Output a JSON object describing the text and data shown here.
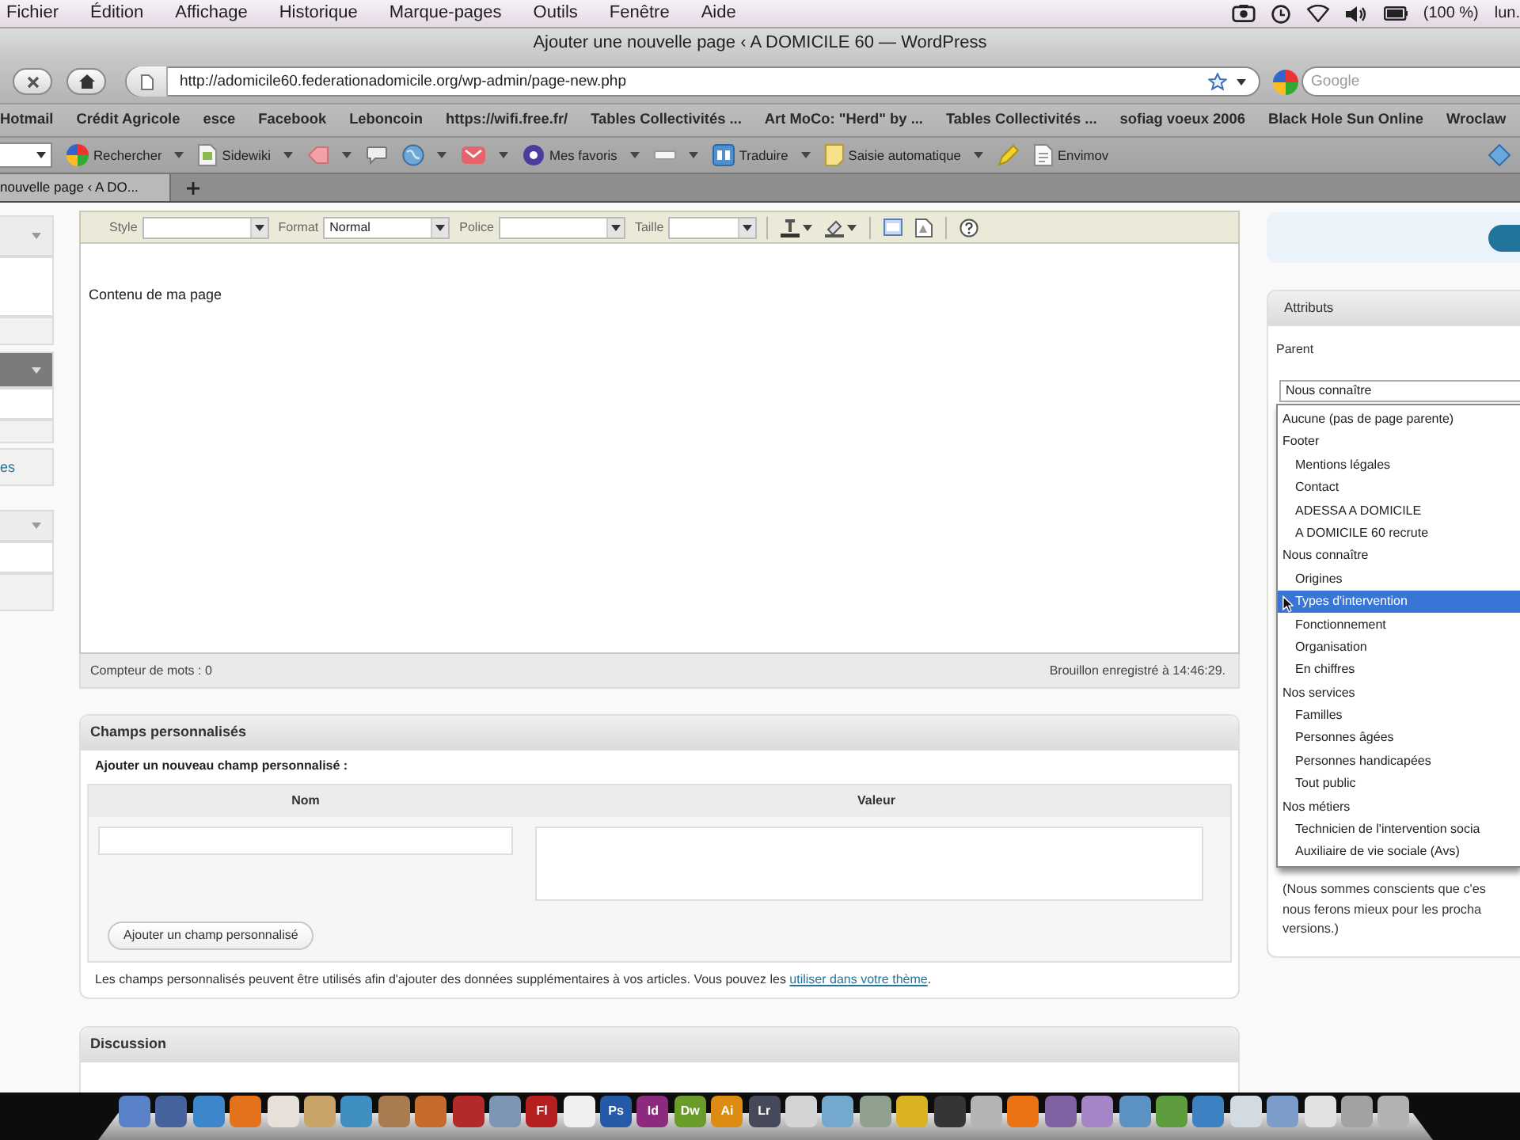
{
  "menu_bar": {
    "items": [
      "Fichier",
      "Édition",
      "Affichage",
      "Historique",
      "Marque-pages",
      "Outils",
      "Fenêtre",
      "Aide"
    ],
    "battery": "(100 %)",
    "clock": "lun."
  },
  "window": {
    "title": "Ajouter une nouvelle page ‹ A DOMICILE 60 — WordPress"
  },
  "nav_bar": {
    "url": "http://adomicile60.federationadomicile.org/wp-admin/page-new.php",
    "search": {
      "placeholder": "Google"
    }
  },
  "bookmarks": [
    "Hotmail",
    "Crédit Agricole",
    "esce",
    "Facebook",
    "Leboncoin",
    "https://wifi.free.fr/",
    "Tables Collectivités ...",
    "Art MoCo: \"Herd\" by ...",
    "Tables Collectivités ...",
    "sofiag voeux 2006",
    "Black Hole Sun Online",
    "Wroclaw"
  ],
  "google_toolbar": {
    "items": [
      {
        "label": "Rechercher",
        "menu": true
      },
      {
        "label": "Sidewiki",
        "menu": true
      },
      {
        "menu": true
      },
      {
        "menu": false
      },
      {
        "menu": true
      },
      {
        "menu": true
      },
      {
        "label": "Mes favoris",
        "menu": true
      },
      {
        "menu": true
      },
      {
        "label": "Traduire",
        "menu": true
      },
      {
        "label": "Saisie automatique",
        "menu": true
      },
      {
        "menu": false
      },
      {
        "label": "Envimov",
        "menu": false
      }
    ]
  },
  "tabs": [
    {
      "label": "nouvelle page ‹ A DO...",
      "selected": true
    }
  ],
  "admin_menu": {
    "link_fragment": "es"
  },
  "editor": {
    "selects": [
      {
        "label": "Style"
      },
      {
        "label": "Format",
        "value": "Normal"
      },
      {
        "label": "Police"
      },
      {
        "label": "Taille"
      }
    ],
    "content": "Contenu de ma page",
    "word_count": "Compteur de mots : 0",
    "draft_status": "Brouillon enregistré à 14:46:29."
  },
  "custom_fields": {
    "title": "Champs personnalisés",
    "subtitle": "Ajouter un nouveau champ personnalisé :",
    "columns": [
      "Nom",
      "Valeur"
    ],
    "add_button": "Ajouter un champ personnalisé",
    "note": "Les champs personnalisés peuvent être utilisés afin d'ajouter des données supplémentaires à vos articles. Vous pouvez les",
    "note_link": "utiliser dans votre thème",
    "note_end": "."
  },
  "discussion": {
    "title": "Discussion"
  },
  "attributes": {
    "title": "Attributs",
    "parent_label": "Parent",
    "parent_value": "Nous connaître",
    "options": [
      {
        "label": "Aucune (pas de page parente)",
        "selected": false
      },
      {
        "label": "Footer",
        "selected": false,
        "children": [
          {
            "label": "Mentions légales",
            "selected": false
          },
          {
            "label": "Contact",
            "selected": false
          },
          {
            "label": "ADESSA A DOMICILE",
            "selected": false
          },
          {
            "label": "A DOMICILE 60 recrute",
            "selected": false
          }
        ]
      },
      {
        "label": "Nous connaître",
        "selected": false,
        "children": [
          {
            "label": "Origines",
            "selected": false
          },
          {
            "label": "Types d'intervention",
            "selected": true
          },
          {
            "label": "Fonctionnement",
            "selected": false
          },
          {
            "label": "Organisation",
            "selected": false
          },
          {
            "label": "En chiffres",
            "selected": false
          }
        ]
      },
      {
        "label": "Nos services",
        "selected": false,
        "children": [
          {
            "label": "Familles",
            "selected": false
          },
          {
            "label": "Personnes âgées",
            "selected": false
          },
          {
            "label": "Personnes handicapées",
            "selected": false
          },
          {
            "label": "Tout public",
            "selected": false
          }
        ]
      },
      {
        "label": "Nos métiers",
        "selected": false,
        "children": [
          {
            "label": "Technicien de l'intervention socia",
            "selected": false
          },
          {
            "label": "Auxiliaire de vie sociale (Avs)",
            "selected": false
          }
        ]
      }
    ],
    "note_lines": [
      "(Nous sommes conscients que c'es",
      "nous ferons mieux pour les procha",
      "versions.)"
    ]
  },
  "dock": {
    "apps": [
      {
        "color": "#5a82c8"
      },
      {
        "color": "#46639e"
      },
      {
        "color": "#3c86c9"
      },
      {
        "color": "#e2731c"
      },
      {
        "color": "#e6e0d8"
      },
      {
        "color": "#c8a468"
      },
      {
        "color": "#3f8fc2"
      },
      {
        "color": "#a87c50"
      },
      {
        "color": "#c46a2a"
      },
      {
        "color": "#b42a2a"
      },
      {
        "color": "#7c96b4"
      },
      {
        "color": "#b51f1f",
        "label": "Fl"
      },
      {
        "color": "#efefef"
      },
      {
        "color": "#245aa6",
        "label": "Ps"
      },
      {
        "color": "#8c2a7e",
        "label": "Id"
      },
      {
        "color": "#6a9c2c",
        "label": "Dw"
      },
      {
        "color": "#dc8c12",
        "label": "Ai"
      },
      {
        "color": "#45495a",
        "label": "Lr"
      },
      {
        "color": "#d4d4d4"
      },
      {
        "color": "#74a8cc"
      },
      {
        "color": "#8fa08f"
      },
      {
        "color": "#d8b222"
      },
      {
        "color": "#353535"
      },
      {
        "color": "#b4b4b4"
      },
      {
        "color": "#ea7414"
      },
      {
        "color": "#7e62a2"
      },
      {
        "color": "#a486c6"
      },
      {
        "color": "#5c92c2"
      },
      {
        "color": "#5c9c3c"
      },
      {
        "color": "#3c82c2"
      },
      {
        "color": "#d2dae2"
      },
      {
        "color": "#7c9cca"
      },
      {
        "color": "#e2e2e2"
      },
      {
        "color": "#a2a2a2"
      },
      {
        "color": "#b2b2b2"
      }
    ]
  }
}
